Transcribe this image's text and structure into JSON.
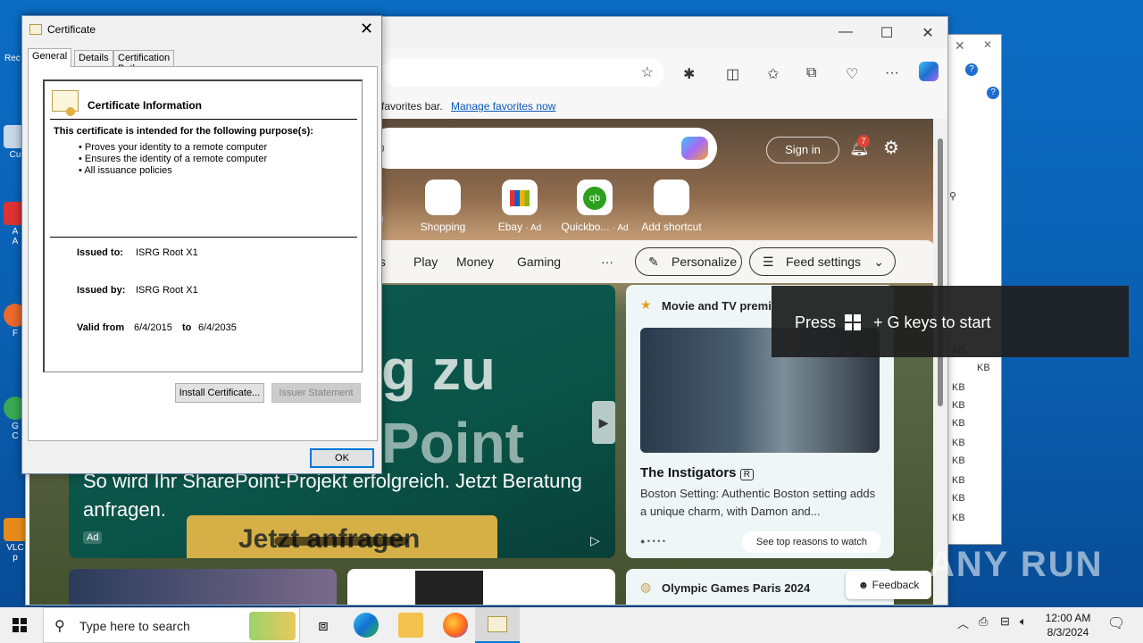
{
  "certificate": {
    "title": "Certificate",
    "tabs": [
      "General",
      "Details",
      "Certification Path"
    ],
    "info_header": "Certificate Information",
    "purpose_heading": "This certificate is intended for the following purpose(s):",
    "purposes": [
      "Proves your identity to a remote computer",
      "Ensures the identity of a remote computer",
      "All issuance policies"
    ],
    "issued_to_label": "Issued to:",
    "issued_to": "ISRG Root X1",
    "issued_by_label": "Issued by:",
    "issued_by": "ISRG Root X1",
    "valid_from_label": "Valid from",
    "valid_from": "6/4/2015",
    "to_label": "to",
    "valid_to": "6/4/2035",
    "install_button": "Install Certificate...",
    "issuer_statement_button": "Issuer Statement",
    "ok_button": "OK"
  },
  "browser": {
    "favbar_text": "favorites bar.",
    "manage_favorites": "Manage favorites now",
    "search_placeholder_fragment": "b",
    "sign_in": "Sign in",
    "notification_count": "7",
    "shortcuts": [
      {
        "label": "Shopping",
        "ad": ""
      },
      {
        "label": "Ebay",
        "ad": "· Ad"
      },
      {
        "label": "Quickbo...",
        "ad": "· Ad"
      },
      {
        "label": "Add shortcut",
        "ad": ""
      }
    ],
    "left_ad_fragment": "Ad",
    "nav": {
      "partial": "ts",
      "play": "Play",
      "money": "Money",
      "gaming": "Gaming",
      "more": "···",
      "personalize": "Personalize",
      "feed_settings": "Feed settings"
    },
    "hero": {
      "big1": "g zu",
      "big2": "Point",
      "text": "So wird Ihr SharePoint-Projekt erfolgreich. Jetzt Beratung anfragen.",
      "button_text": "Jetzt anfragen",
      "ad_label": "Ad"
    },
    "movie": {
      "heading": "Movie and TV premi",
      "title": "The Instigators",
      "rating": "R",
      "description": "Boston Setting: Authentic Boston setting adds a unique charm, with Damon and...",
      "see_reasons": "See top reasons to watch"
    },
    "olympics": "Olympic Games Paris 2024",
    "feedback": "Feedback"
  },
  "background_window": {
    "kb_labels": [
      "KB",
      "KB",
      "KB",
      "KB",
      "KB",
      "KB",
      "KB",
      "KB",
      "KB",
      "KB"
    ]
  },
  "toast": {
    "press": "Press",
    "keys": "+ G keys to start"
  },
  "taskbar": {
    "search_placeholder": "Type here to search",
    "time": "12:00 AM",
    "date": "8/3/2024"
  },
  "desktop": {
    "labels": [
      "Rec",
      "Cu",
      "A",
      "A",
      "F",
      "G",
      "C",
      "VLC",
      "p"
    ]
  },
  "watermark": "ANY RUN"
}
